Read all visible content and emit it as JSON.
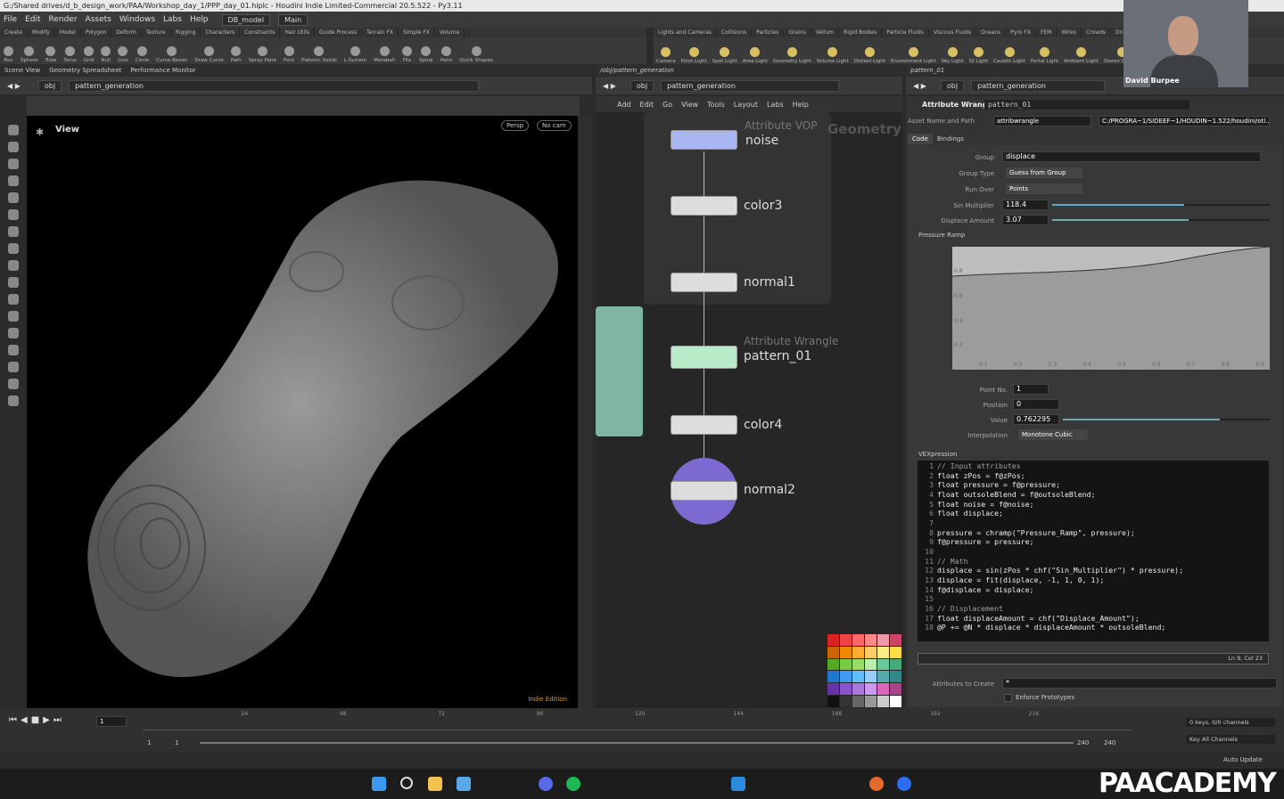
{
  "window_title": "G:/Shared drives/d_b_design_work/PAA/Workshop_day_1/PPP_day_01.hiplc - Houdini Indie Limited-Commercial 20.5.522 - Py3.11",
  "menu": [
    "File",
    "Edit",
    "Render",
    "Assets",
    "Windows",
    "Labs",
    "Help"
  ],
  "desktop": "DB_model",
  "desktop2": "Main",
  "shelf_tabs": [
    "Create",
    "Modify",
    "Model",
    "Polygon",
    "Deform",
    "Texture",
    "Rigging",
    "Characters",
    "Constraints",
    "Hair Utils",
    "Guide Process",
    "Terrain FX",
    "Simple FX",
    "Volume"
  ],
  "shelf_tools": [
    "Box",
    "Sphere",
    "Tube",
    "Torus",
    "Grid",
    "Null",
    "Line",
    "Circle",
    "Curve Bezier",
    "Draw Curve",
    "Path",
    "Spray Paint",
    "Font",
    "Platonic Solids",
    "L-System",
    "Metaball",
    "File",
    "Spiral",
    "Helix",
    "Quick Shapes"
  ],
  "light_tabs": [
    "Lights and Cameras",
    "Collisions",
    "Particles",
    "Grains",
    "Vellum",
    "Rigid Bodies",
    "Particle Fluids",
    "Viscous Fluids",
    "Oceans",
    "Pyro FX",
    "FEM",
    "Wires",
    "Crowds",
    "Drive Simulati"
  ],
  "light_tools": [
    "Camera",
    "Point Light",
    "Spot Light",
    "Area Light",
    "Geometry Light",
    "Volume Light",
    "Distant Light",
    "Environment Light",
    "Sky Light",
    "GI Light",
    "Caustic Light",
    "Portal Light",
    "Ambient Light",
    "Stereo Camera"
  ],
  "left_tabs": [
    "Scene View",
    "Geometry Spreadsheet",
    "Performance Monitor"
  ],
  "mid_tabs": [
    "/obj/pattern_generation"
  ],
  "right_tabs": [
    "pattern_01"
  ],
  "path_obj": "obj",
  "path_node": "pattern_generation",
  "viewport": {
    "label": "View",
    "persp": "Persp",
    "cam": "No cam",
    "edition": "Indie Edition"
  },
  "net_menu": [
    "Add",
    "Edit",
    "Go",
    "View",
    "Tools",
    "Layout",
    "Labs",
    "Help"
  ],
  "net_bg_label": "Geometry",
  "nodes": [
    {
      "name": "noise",
      "type": "Attribute VOP"
    },
    {
      "name": "color3",
      "type": ""
    },
    {
      "name": "normal1",
      "type": ""
    },
    {
      "name": "pattern_01",
      "type": "Attribute Wrangle"
    },
    {
      "name": "color4",
      "type": ""
    },
    {
      "name": "normal2",
      "type": ""
    }
  ],
  "params": {
    "node_type": "Attribute Wrangle",
    "node_name": "pattern_01",
    "asset_label": "Asset Name and Path",
    "asset_name": "attribwrangle",
    "asset_path": "C:/PROGRA~1/SIDEEF~1/HOUDIN~1.522/houdini/otl...",
    "tabs": [
      "Code",
      "Bindings"
    ],
    "group_label": "Group",
    "group_val": "displace",
    "group_type_label": "Group Type",
    "group_type_val": "Guess from Group",
    "run_over_label": "Run Over",
    "run_over_val": "Points",
    "sin_label": "Sin Multiplier",
    "sin_val": "118.4",
    "disp_label": "Displace Amount",
    "disp_val": "3.07",
    "ramp_label": "Pressure Ramp",
    "ramp_y": [
      "0.8",
      "0.6",
      "0.4",
      "0.2"
    ],
    "ramp_x": [
      "0.1",
      "0.2",
      "0.3",
      "0.4",
      "0.5",
      "0.6",
      "0.7",
      "0.8",
      "0.9"
    ],
    "pt_no_label": "Point No.",
    "pt_no_val": "1",
    "pos_label": "Position",
    "pos_val": "0",
    "value_label": "Value",
    "value_val": "0.762295",
    "interp_label": "Interpolation",
    "interp_val": "Monotone Cubic",
    "vex_label": "VEXpression",
    "status": "Ln 9, Col 23",
    "attr_create_label": "Attributes to Create",
    "attr_create_val": "*",
    "enforce": "Enforce Prototypes"
  },
  "code": [
    "// Input attributes",
    "float zPos = f@zPos;",
    "float pressure = f@pressure;",
    "float outsoleBlend = f@outsoleBlend;",
    "float noise = f@noise;",
    "float displace;",
    "",
    "pressure = chramp(\"Pressure_Ramp\", pressure);",
    "f@pressure = pressure;",
    "",
    "// Math",
    "displace = sin(zPos * chf(\"Sin_Multiplier\") * pressure);",
    "displace = fit(displace, -1, 1, 0, 1);",
    "f@displace = displace;",
    "",
    "// Displacement",
    "float displaceAmount = chf(\"Displace_Amount\");",
    "@P += @N * displace * displaceAmount * outsoleBlend;"
  ],
  "timeline": {
    "frame": "1",
    "ticks": [
      "24",
      "48",
      "72",
      "96",
      "120",
      "144",
      "168",
      "192",
      "216"
    ],
    "start": "1",
    "start2": "1",
    "end": "240",
    "end2": "240",
    "keys": "0 keys, 0/0 channels",
    "key_all": "Key All Channels",
    "auto": "Auto Update"
  },
  "presenter": "David Burpee",
  "brand": "PAACADEMY"
}
